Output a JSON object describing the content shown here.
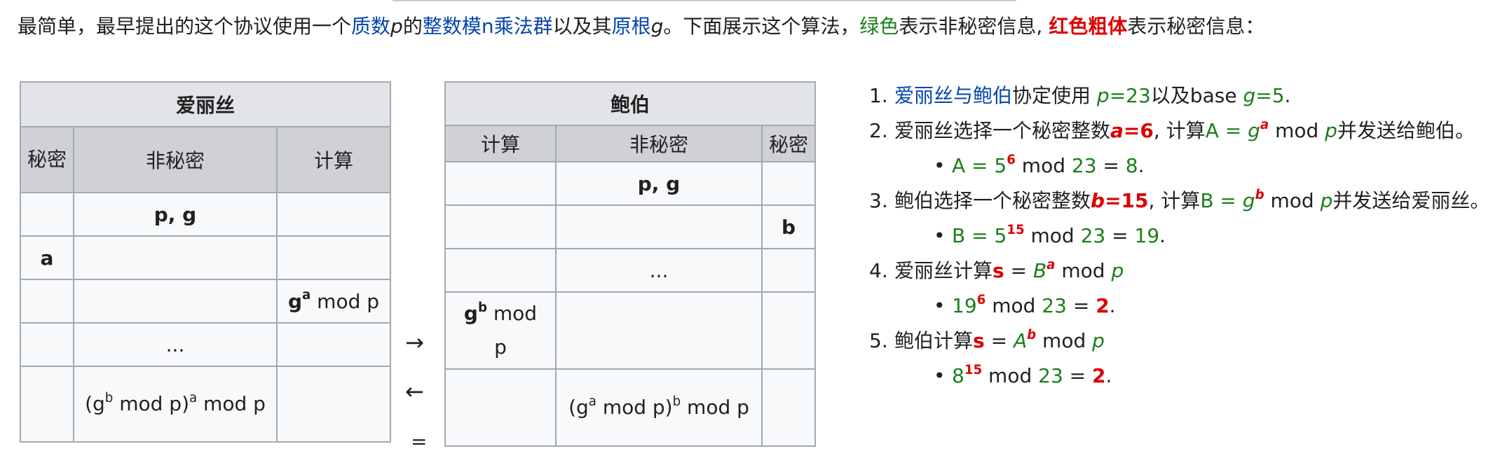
{
  "intro": {
    "t1": "最简单，最早提出的这个协议使用一个",
    "link1": "质数",
    "p": "p",
    "t2": "的",
    "link2": "整数模n乘法群",
    "t3": "以及其",
    "link3": "原根",
    "g": "g",
    "t4": "。下面展示这个算法，",
    "green_word": "绿色",
    "t5": "表示非秘密信息, ",
    "red_word": "红色粗体",
    "t6": "表示秘密信息："
  },
  "alice_table": {
    "title": "爱丽丝",
    "headers": [
      "秘密",
      "非秘密",
      "计算"
    ],
    "r1_public": "p, g",
    "r2_secret": "a",
    "r3_compute_base": "g",
    "r3_compute_exp": "a",
    "r3_compute_tail": " mod p",
    "r4_public": "...",
    "r5_base": "(g",
    "r5_exp1": "b",
    "r5_mid": " mod p)",
    "r5_exp2": "a",
    "r5_tail": " mod p"
  },
  "arrows": {
    "right": "→",
    "left": "←",
    "equals": "="
  },
  "bob_table": {
    "title": "鲍伯",
    "headers": [
      "计算",
      "非秘密",
      "秘密"
    ],
    "r1_public": "p, g",
    "r2_secret": "b",
    "r3_public": "...",
    "r4_base": "g",
    "r4_exp": "b",
    "r4_tail": " mod p",
    "r5_base": "(g",
    "r5_exp1": "a",
    "r5_mid": " mod p)",
    "r5_exp2": "b",
    "r5_tail": " mod p"
  },
  "steps": {
    "s1": {
      "num": "1.",
      "link": "爱丽丝与鲍伯",
      "text": "协定使用 ",
      "p_var": "p",
      "p_val": "=23",
      "mid": "以及base ",
      "g_var": "g",
      "g_val": "=5",
      "end": "."
    },
    "s2": {
      "num": "2.",
      "text": "爱丽丝选择一个秘密整数",
      "a_var": "a",
      "a_val": "=6",
      "mid": ", 计算",
      "A": "A = ",
      "g": "g",
      "exp": "a",
      "mod": " mod ",
      "p": "p",
      "end": "并发送给鲍伯。",
      "bullet": {
        "lhs": "A = 5",
        "exp": "6",
        "mod": " mod ",
        "n": "23",
        "eq": " = ",
        "res": "8",
        "end": "."
      }
    },
    "s3": {
      "num": "3.",
      "text": "鲍伯选择一个秘密整数",
      "b_var": "b",
      "b_val": "=15",
      "mid": ", 计算",
      "B": "B = ",
      "g": "g",
      "exp": "b",
      "mod": " mod ",
      "p": "p",
      "end": "并发送给爱丽丝。",
      "bullet": {
        "lhs": "B = 5",
        "exp": "15",
        "mod": " mod ",
        "n": "23",
        "eq": " = ",
        "res": "19",
        "end": "."
      }
    },
    "s4": {
      "num": "4.",
      "text": "爱丽丝计算",
      "s": "s",
      "eq": " = ",
      "B": "B",
      "exp": "a",
      "mod": " mod ",
      "p": "p",
      "bullet": {
        "base": "19",
        "exp": "6",
        "mod": " mod ",
        "n": "23",
        "eq": " = ",
        "res": "2",
        "end": "."
      }
    },
    "s5": {
      "num": "5.",
      "text": "鲍伯计算",
      "s": "s",
      "eq": " = ",
      "A": "A",
      "exp": "b",
      "mod": " mod ",
      "p": "p",
      "bullet": {
        "base": "8",
        "exp": "15",
        "mod": " mod ",
        "n": "23",
        "eq": " = ",
        "res": "2",
        "end": "."
      }
    }
  },
  "colors": {
    "link": "#0645ad",
    "green": "#1a7f1a",
    "red": "#dd0000",
    "header_bg": "#cfd1d4",
    "border": "#a2a9b1"
  }
}
